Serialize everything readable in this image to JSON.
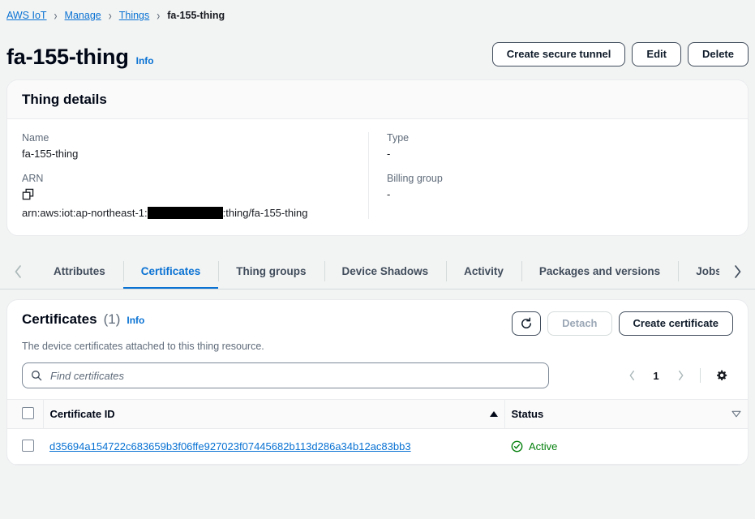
{
  "breadcrumb": {
    "items": [
      {
        "label": "AWS IoT",
        "current": false
      },
      {
        "label": "Manage",
        "current": false
      },
      {
        "label": "Things",
        "current": false
      },
      {
        "label": "fa-155-thing",
        "current": true
      }
    ],
    "separator": "›"
  },
  "page": {
    "title": "fa-155-thing",
    "info_label": "Info"
  },
  "header_actions": {
    "create_tunnel": "Create secure tunnel",
    "edit": "Edit",
    "delete": "Delete"
  },
  "thing_details": {
    "heading": "Thing details",
    "name_label": "Name",
    "name_value": "fa-155-thing",
    "arn_label": "ARN",
    "arn_prefix": "arn:aws:iot:ap-northeast-1:",
    "arn_suffix": ":thing/fa-155-thing",
    "arn_redacted": true,
    "copy_icon": "copy-icon",
    "type_label": "Type",
    "type_value": "-",
    "billing_group_label": "Billing group",
    "billing_group_value": "-"
  },
  "tabs": {
    "prev_icon": "chevron-left-icon",
    "next_icon": "chevron-right-icon",
    "items": [
      {
        "label": "Attributes",
        "active": false
      },
      {
        "label": "Certificates",
        "active": true
      },
      {
        "label": "Thing groups",
        "active": false
      },
      {
        "label": "Device Shadows",
        "active": false
      },
      {
        "label": "Activity",
        "active": false
      },
      {
        "label": "Packages and versions",
        "active": false
      },
      {
        "label": "Jobs",
        "active": false
      }
    ]
  },
  "certificates_panel": {
    "title": "Certificates",
    "count": "(1)",
    "info_label": "Info",
    "description": "The device certificates attached to this thing resource.",
    "refresh_icon": "refresh-icon",
    "detach_label": "Detach",
    "detach_disabled": true,
    "create_label": "Create certificate",
    "search": {
      "icon": "search-icon",
      "placeholder": "Find certificates",
      "value": ""
    },
    "pagination": {
      "prev_icon": "chevron-left-icon",
      "page": "1",
      "next_icon": "chevron-right-icon",
      "settings_icon": "gear-icon"
    },
    "table": {
      "columns": [
        {
          "label": "Certificate ID",
          "sort": "asc"
        },
        {
          "label": "Status",
          "sort": "none"
        }
      ],
      "rows": [
        {
          "certificate_id": "d35694a154722c683659b3f06ffe927023f07445682b113d286a34b12ac83bb3",
          "status": "Active",
          "status_icon": "status-positive-icon",
          "selected": false
        }
      ]
    }
  },
  "colors": {
    "link": "#0972d3",
    "page_bg": "#f2f3f3",
    "card_bg": "#ffffff",
    "header_bg": "#fafafa",
    "border": "#e9ebed",
    "text": "#16191f",
    "muted": "#5f6b7a",
    "success": "#037f0c",
    "disabled": "#9ba7b6"
  }
}
